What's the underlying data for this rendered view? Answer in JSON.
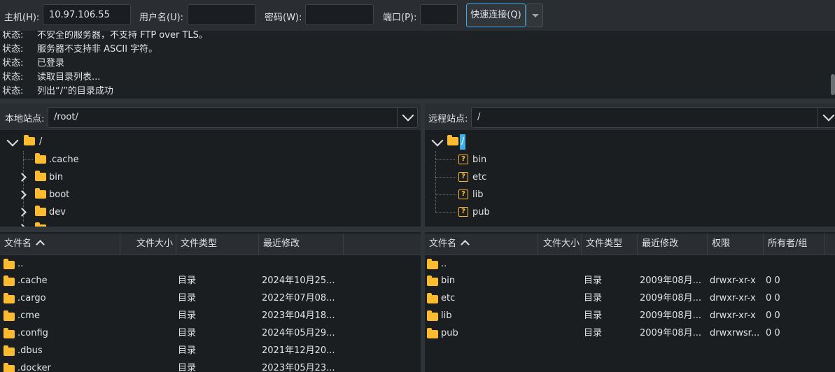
{
  "quickconnect": {
    "host_label": "主机(H):",
    "host_value": "10.97.106.55",
    "user_label": "用户名(U):",
    "user_value": "",
    "password_label": "密码(W):",
    "password_value": "",
    "port_label": "端口(P):",
    "port_value": "",
    "connect_label": "快速连接(Q)"
  },
  "log": [
    {
      "tag": "状态:",
      "text": "不安全的服务器，不支持 FTP over TLS。"
    },
    {
      "tag": "状态:",
      "text": "服务器不支持非 ASCII 字符。"
    },
    {
      "tag": "状态:",
      "text": "已登录"
    },
    {
      "tag": "状态:",
      "text": "读取目录列表..."
    },
    {
      "tag": "状态:",
      "text": "列出“/”的目录成功"
    }
  ],
  "local": {
    "site_label": "本地站点:",
    "site_path": "/root/",
    "tree": {
      "root": "/",
      "children": [
        ".cache",
        "bin",
        "boot",
        "dev"
      ]
    },
    "columns": [
      "文件名",
      "文件大小",
      "文件类型",
      "最近修改"
    ],
    "rows": [
      {
        "name": "..",
        "size": "",
        "type": "",
        "modified": ""
      },
      {
        "name": ".cache",
        "size": "",
        "type": "目录",
        "modified": "2024年10月25..."
      },
      {
        "name": ".cargo",
        "size": "",
        "type": "目录",
        "modified": "2022年07月08..."
      },
      {
        "name": ".cme",
        "size": "",
        "type": "目录",
        "modified": "2023年04月18..."
      },
      {
        "name": ".config",
        "size": "",
        "type": "目录",
        "modified": "2024年05月29..."
      },
      {
        "name": ".dbus",
        "size": "",
        "type": "目录",
        "modified": "2021年12月20..."
      },
      {
        "name": ".docker",
        "size": "",
        "type": "目录",
        "modified": "2023年05月23..."
      }
    ]
  },
  "remote": {
    "site_label": "远程站点:",
    "site_path": "/",
    "tree": {
      "root": "/",
      "children": [
        "bin",
        "etc",
        "lib",
        "pub"
      ]
    },
    "columns": [
      "文件名",
      "文件大小",
      "文件类型",
      "最近修改",
      "权限",
      "所有者/组"
    ],
    "rows": [
      {
        "name": "..",
        "size": "",
        "type": "",
        "modified": "",
        "perms": "",
        "owner": ""
      },
      {
        "name": "bin",
        "size": "",
        "type": "目录",
        "modified": "2009年08月...",
        "perms": "drwxr-xr-x",
        "owner": "0 0"
      },
      {
        "name": "etc",
        "size": "",
        "type": "目录",
        "modified": "2009年08月...",
        "perms": "drwxr-xr-x",
        "owner": "0 0"
      },
      {
        "name": "lib",
        "size": "",
        "type": "目录",
        "modified": "2009年08月...",
        "perms": "drwxr-xr-x",
        "owner": "0 0"
      },
      {
        "name": "pub",
        "size": "",
        "type": "目录",
        "modified": "2009年08月...",
        "perms": "drwxrwsr...",
        "owner": "0 0"
      }
    ]
  },
  "icons": {
    "folder": "folder-icon",
    "unknown_folder": "question-folder-icon",
    "expand": "chevron-right-icon",
    "collapse": "chevron-down-icon",
    "sort": "sort-ascending-icon"
  },
  "colors": {
    "accent": "#3daee9",
    "folder": "#fdbc2f",
    "background": "#1e2124"
  }
}
